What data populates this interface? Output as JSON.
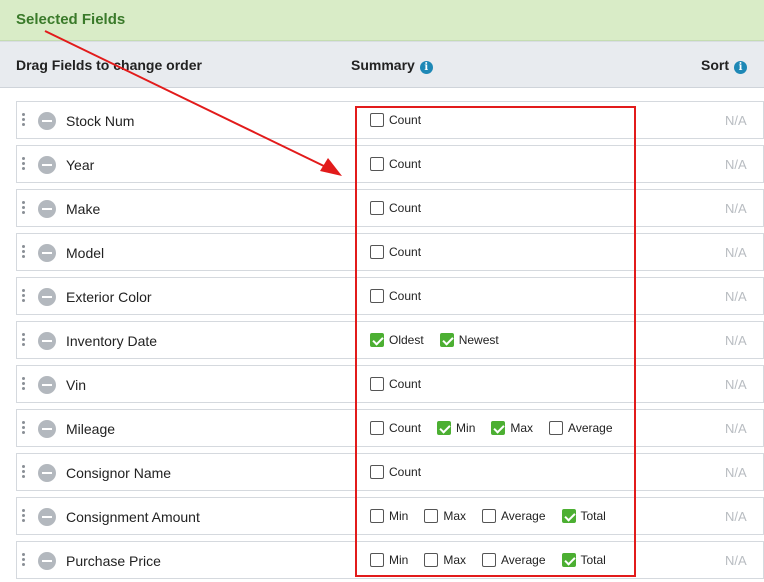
{
  "panel": {
    "title": "Selected Fields"
  },
  "header": {
    "drag_label": "Drag Fields to change order",
    "summary_label": "Summary",
    "sort_label": "Sort",
    "info_glyph": "i"
  },
  "rows": [
    {
      "name": "Stock Num",
      "sort": "N/A",
      "options": [
        {
          "label": "Count",
          "checked": false
        }
      ]
    },
    {
      "name": "Year",
      "sort": "N/A",
      "options": [
        {
          "label": "Count",
          "checked": false
        }
      ]
    },
    {
      "name": "Make",
      "sort": "N/A",
      "options": [
        {
          "label": "Count",
          "checked": false
        }
      ]
    },
    {
      "name": "Model",
      "sort": "N/A",
      "options": [
        {
          "label": "Count",
          "checked": false
        }
      ]
    },
    {
      "name": "Exterior Color",
      "sort": "N/A",
      "options": [
        {
          "label": "Count",
          "checked": false
        }
      ]
    },
    {
      "name": "Inventory Date",
      "sort": "N/A",
      "options": [
        {
          "label": "Oldest",
          "checked": true
        },
        {
          "label": "Newest",
          "checked": true
        }
      ]
    },
    {
      "name": "Vin",
      "sort": "N/A",
      "options": [
        {
          "label": "Count",
          "checked": false
        }
      ]
    },
    {
      "name": "Mileage",
      "sort": "N/A",
      "options": [
        {
          "label": "Count",
          "checked": false
        },
        {
          "label": "Min",
          "checked": true
        },
        {
          "label": "Max",
          "checked": true
        },
        {
          "label": "Average",
          "checked": false
        }
      ]
    },
    {
      "name": "Consignor Name",
      "sort": "N/A",
      "options": [
        {
          "label": "Count",
          "checked": false
        }
      ]
    },
    {
      "name": "Consignment Amount",
      "sort": "N/A",
      "options": [
        {
          "label": "Min",
          "checked": false
        },
        {
          "label": "Max",
          "checked": false
        },
        {
          "label": "Average",
          "checked": false
        },
        {
          "label": "Total",
          "checked": true
        }
      ]
    },
    {
      "name": "Purchase Price",
      "sort": "N/A",
      "options": [
        {
          "label": "Min",
          "checked": false
        },
        {
          "label": "Max",
          "checked": false
        },
        {
          "label": "Average",
          "checked": false
        },
        {
          "label": "Total",
          "checked": true
        }
      ]
    }
  ],
  "colors": {
    "annotation": "#e21b1b",
    "checked": "#4caf32",
    "title_text": "#3a7a2a",
    "info_icon": "#1e88b6"
  }
}
